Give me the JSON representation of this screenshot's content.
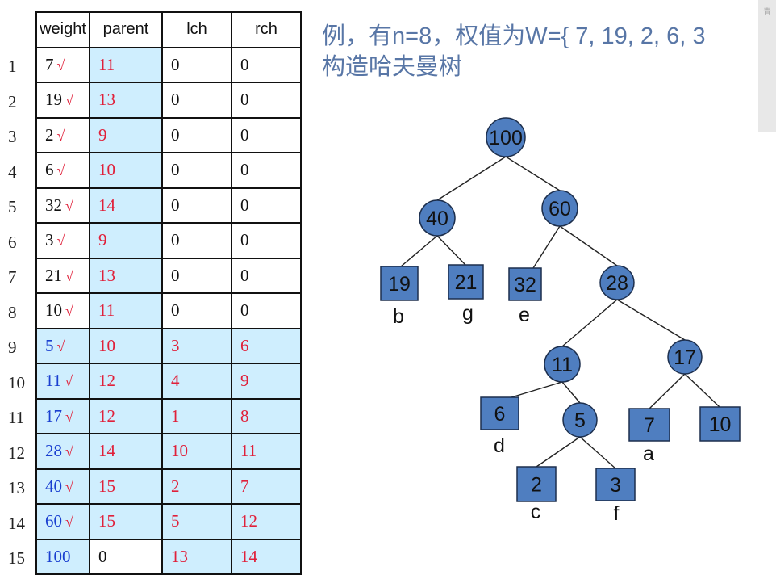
{
  "title_line1": "例，有n=8，权值为W={ 7, 19, 2, 6, 3",
  "title_line2": "构造哈夫曼树",
  "corner_char": "青",
  "headers": {
    "weight": "weight",
    "parent": "parent",
    "lch": "lch",
    "rch": "rch"
  },
  "check": "√",
  "rows": [
    {
      "n": "1",
      "w": "7",
      "p": "11",
      "l": "0",
      "r": "0"
    },
    {
      "n": "2",
      "w": "19",
      "p": "13",
      "l": "0",
      "r": "0"
    },
    {
      "n": "3",
      "w": "2",
      "p": "9",
      "l": "0",
      "r": "0"
    },
    {
      "n": "4",
      "w": "6",
      "p": "10",
      "l": "0",
      "r": "0"
    },
    {
      "n": "5",
      "w": "32",
      "p": "14",
      "l": "0",
      "r": "0"
    },
    {
      "n": "6",
      "w": "3",
      "p": "9",
      "l": "0",
      "r": "0"
    },
    {
      "n": "7",
      "w": "21",
      "p": "13",
      "l": "0",
      "r": "0"
    },
    {
      "n": "8",
      "w": "10",
      "p": "11",
      "l": "0",
      "r": "0"
    },
    {
      "n": "9",
      "w": "5",
      "p": "10",
      "l": "3",
      "r": "6"
    },
    {
      "n": "10",
      "w": "11",
      "p": "12",
      "l": "4",
      "r": "9"
    },
    {
      "n": "11",
      "w": "17",
      "p": "12",
      "l": "1",
      "r": "8"
    },
    {
      "n": "12",
      "w": "28",
      "p": "14",
      "l": "10",
      "r": "11"
    },
    {
      "n": "13",
      "w": "40",
      "p": "15",
      "l": "2",
      "r": "7"
    },
    {
      "n": "14",
      "w": "60",
      "p": "15",
      "l": "5",
      "r": "12"
    },
    {
      "n": "15",
      "w": "100",
      "p": "0",
      "l": "13",
      "r": "14"
    }
  ],
  "tree": {
    "internal": [
      "100",
      "40",
      "60",
      "28",
      "11",
      "17",
      "5"
    ],
    "leaves": [
      {
        "value": "19",
        "label": "b"
      },
      {
        "value": "21",
        "label": "g"
      },
      {
        "value": "32",
        "label": "e"
      },
      {
        "value": "6",
        "label": "d"
      },
      {
        "value": "7",
        "label": "a"
      },
      {
        "value": "10",
        "label": ""
      },
      {
        "value": "2",
        "label": "c"
      },
      {
        "value": "3",
        "label": "f"
      }
    ]
  },
  "colors": {
    "node_fill": "#4f7ec0",
    "node_stroke": "#1d2f4d",
    "highlight": "#cfeefe",
    "red": "#e0203a",
    "blue": "#1a3fd0",
    "title": "#5876a6"
  }
}
